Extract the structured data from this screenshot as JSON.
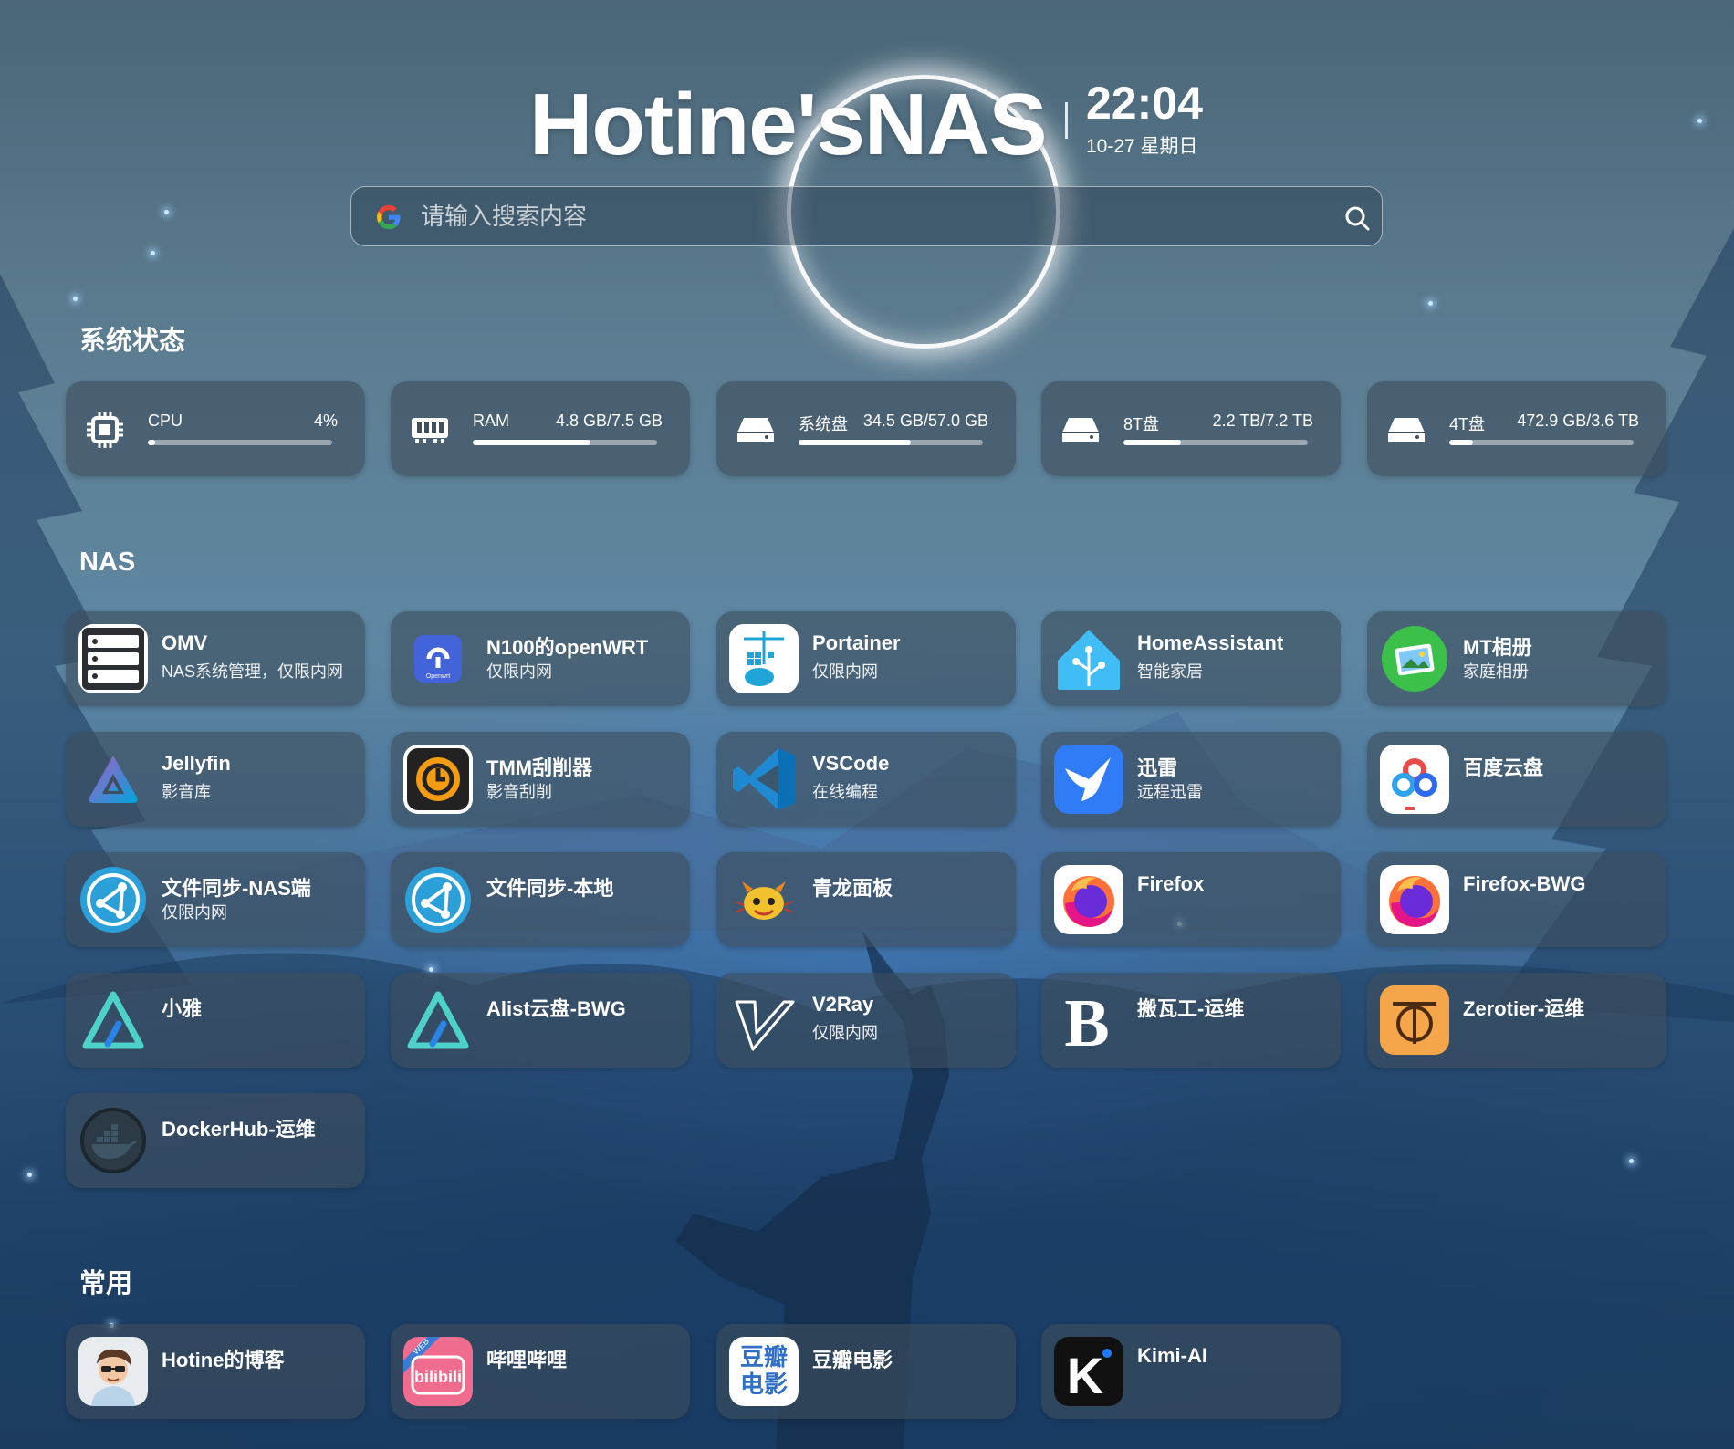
{
  "header": {
    "title": "Hotine'sNAS",
    "time": "22:04",
    "date": "10-27 星期日"
  },
  "search": {
    "engine_icon": "google-icon",
    "placeholder": "请输入搜索内容",
    "button_icon": "search-icon"
  },
  "sections": {
    "status": "系统状态",
    "nas": "NAS",
    "common": "常用"
  },
  "status": [
    {
      "icon": "cpu-icon",
      "label": "CPU",
      "value": "4%",
      "usage": 0.04
    },
    {
      "icon": "ram-icon",
      "label": "RAM",
      "value": "4.8 GB/7.5 GB",
      "usage": 0.64
    },
    {
      "icon": "disk-icon",
      "label": "系统盘",
      "value": "34.5 GB/57.0 GB",
      "usage": 0.61
    },
    {
      "icon": "disk-icon",
      "label": "8T盘",
      "value": "2.2 TB/7.2 TB",
      "usage": 0.31
    },
    {
      "icon": "disk-icon",
      "label": "4T盘",
      "value": "472.9 GB/3.6 TB",
      "usage": 0.13
    }
  ],
  "nas_apps": [
    {
      "name": "OMV",
      "desc": "NAS系统管理，仅限内网",
      "icon": "omv-icon"
    },
    {
      "name": "N100的openWRT",
      "desc": "仅限内网",
      "icon": "openwrt-icon",
      "icon_text": "Openwrt"
    },
    {
      "name": "Portainer",
      "desc": "仅限内网",
      "icon": "portainer-icon"
    },
    {
      "name": "HomeAssistant",
      "desc": "智能家居",
      "icon": "homeassistant-icon"
    },
    {
      "name": "MT相册",
      "desc": "家庭相册",
      "icon": "photo-album-icon"
    },
    {
      "name": "Jellyfin",
      "desc": "影音库",
      "icon": "jellyfin-icon"
    },
    {
      "name": "TMM刮削器",
      "desc": "影音刮削",
      "icon": "tmm-icon"
    },
    {
      "name": "VSCode",
      "desc": "在线编程",
      "icon": "vscode-icon"
    },
    {
      "name": "迅雷",
      "desc": "远程迅雷",
      "icon": "thunder-icon"
    },
    {
      "name": "百度云盘",
      "desc": "",
      "icon": "baidu-netdisk-icon"
    },
    {
      "name": "文件同步-NAS端",
      "desc": "仅限内网",
      "icon": "sync-icon"
    },
    {
      "name": "文件同步-本地",
      "desc": "",
      "icon": "sync-icon"
    },
    {
      "name": "青龙面板",
      "desc": "",
      "icon": "qinglong-icon"
    },
    {
      "name": "Firefox",
      "desc": "",
      "icon": "firefox-icon"
    },
    {
      "name": "Firefox-BWG",
      "desc": "",
      "icon": "firefox-icon"
    },
    {
      "name": "小雅",
      "desc": "",
      "icon": "alist-icon"
    },
    {
      "name": "Alist云盘-BWG",
      "desc": "",
      "icon": "alist-icon"
    },
    {
      "name": "V2Ray",
      "desc": "仅限内网",
      "icon": "v2ray-icon"
    },
    {
      "name": "搬瓦工-运维",
      "desc": "",
      "icon": "bandwagon-icon",
      "icon_text": "B"
    },
    {
      "name": "Zerotier-运维",
      "desc": "",
      "icon": "zerotier-icon"
    },
    {
      "name": "DockerHub-运维",
      "desc": "",
      "icon": "docker-icon"
    }
  ],
  "common_apps": [
    {
      "name": "Hotine的博客",
      "desc": "",
      "icon": "avatar-icon"
    },
    {
      "name": "哔哩哔哩",
      "desc": "",
      "icon": "bilibili-icon",
      "icon_text": "bilibili",
      "icon_badge": "WEB"
    },
    {
      "name": "豆瓣电影",
      "desc": "",
      "icon": "douban-icon",
      "icon_text": "豆瓣电影"
    },
    {
      "name": "Kimi-AI",
      "desc": "",
      "icon": "kimi-icon",
      "icon_text": "K"
    }
  ]
}
